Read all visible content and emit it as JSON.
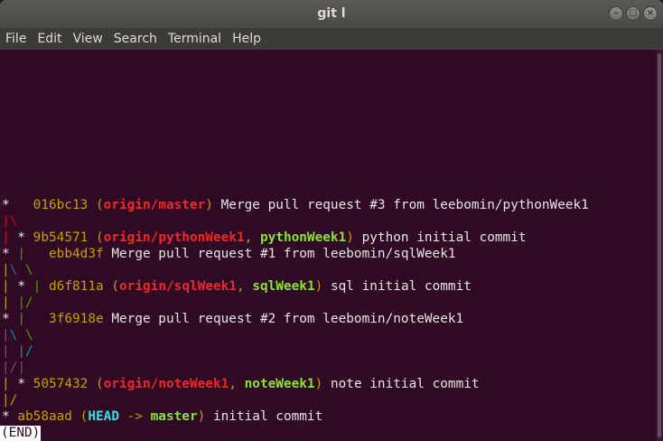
{
  "window": {
    "title": "git l"
  },
  "menu": [
    "File",
    "Edit",
    "View",
    "Search",
    "Terminal",
    "Help"
  ],
  "terminal": {
    "prompt_status": "(END)",
    "commits": [
      {
        "hash": "016bc13",
        "refs": [
          "origin/master"
        ],
        "message": "Merge pull request #3 from leebomin/pythonWeek1"
      },
      {
        "hash": "9b54571",
        "refs": [
          "origin/pythonWeek1",
          "pythonWeek1"
        ],
        "message": "python initial commit"
      },
      {
        "hash": "ebb4d3f",
        "refs": [],
        "message": "Merge pull request #1 from leebomin/sqlWeek1"
      },
      {
        "hash": "d6f811a",
        "refs": [
          "origin/sqlWeek1",
          "sqlWeek1"
        ],
        "message": "sql initial commit"
      },
      {
        "hash": "3f6918e",
        "refs": [],
        "message": "Merge pull request #2 from leebomin/noteWeek1"
      },
      {
        "hash": "5057432",
        "refs": [
          "origin/noteWeek1",
          "noteWeek1"
        ],
        "message": "note initial commit"
      },
      {
        "hash": "ab58aad",
        "refs": [
          "HEAD",
          "master"
        ],
        "message": "initial commit"
      }
    ]
  },
  "colors": {
    "background": "#300a24",
    "hash": "#c4a000",
    "remote_ref": "#ef2929",
    "local_ref": "#8ae234",
    "head_ref": "#34e2e2"
  }
}
